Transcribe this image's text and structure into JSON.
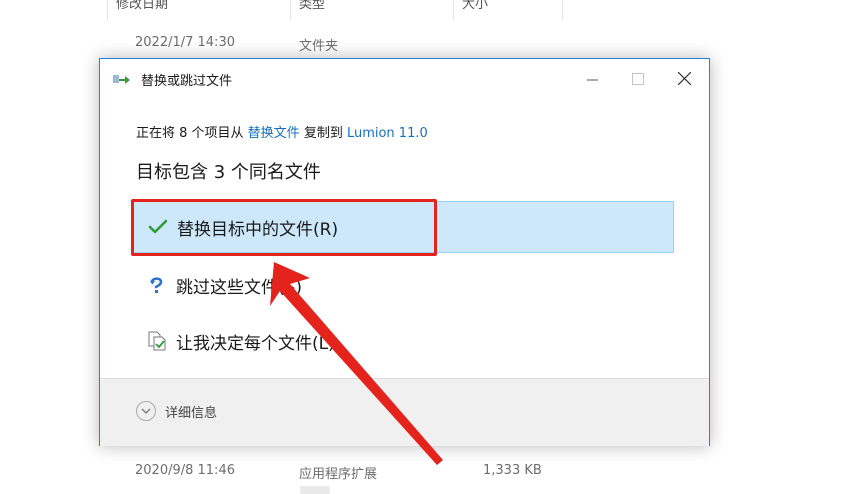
{
  "explorer": {
    "columns": [
      {
        "label": "修改日期"
      },
      {
        "label": "类型"
      },
      {
        "label": "大小"
      }
    ],
    "rows": [
      {
        "date": "2022/1/7 14:30",
        "type": "文件夹",
        "size": ""
      },
      {
        "date": "2020/9/8 11:46",
        "type": "应用程序扩展",
        "size": "1,333 KB"
      }
    ]
  },
  "dialog": {
    "title": "替换或跳过文件",
    "summary": {
      "prefix": "正在将 8 个项目从 ",
      "source": "替换文件",
      "middle": " 复制到 ",
      "target": "Lumion 11.0"
    },
    "heading": "目标包含 3 个同名文件",
    "options": [
      {
        "label": "替换目标中的文件(R)",
        "icon": "checkmark-icon",
        "selected": true
      },
      {
        "label": "跳过这些文件(S)",
        "icon": "skip-icon",
        "selected": false
      },
      {
        "label": "让我决定每个文件(L)",
        "icon": "compare-files-icon",
        "selected": false
      }
    ],
    "details_label": "详细信息"
  },
  "colors": {
    "accent": "#1a6fbf",
    "selection": "#cde8fb",
    "annotation": "#e5231d",
    "check": "#2e9b3a"
  }
}
